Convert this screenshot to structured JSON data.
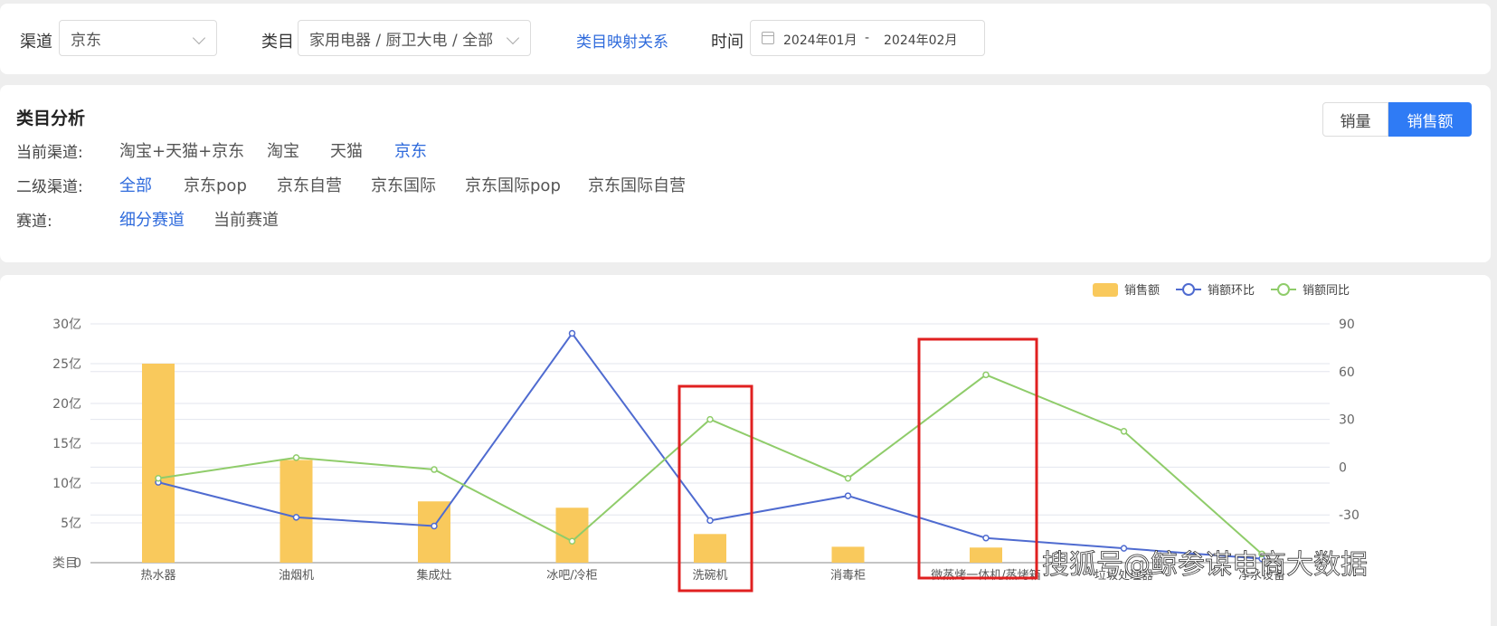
{
  "filters": {
    "channel_label": "渠道",
    "channel_value": "京东",
    "category_label": "类目",
    "category_value": "家用电器 / 厨卫大电 / 全部",
    "mapping_link": "类目映射关系",
    "time_label": "时间",
    "date_start": "2024年01月",
    "date_sep": "-",
    "date_end": "2024年02月"
  },
  "analysis": {
    "title": "类目分析",
    "metric_toggle": [
      "销量",
      "销售额"
    ],
    "active_metric": "销售额",
    "channel_row": {
      "label": "当前渠道:",
      "options": [
        "淘宝+天猫+京东",
        "淘宝",
        "天猫",
        "京东"
      ],
      "active": "京东"
    },
    "subchannel_row": {
      "label": "二级渠道:",
      "options": [
        "全部",
        "京东pop",
        "京东自营",
        "京东国际",
        "京东国际pop",
        "京东国际自营"
      ],
      "active": "全部"
    },
    "track_row": {
      "label": "赛道:",
      "options": [
        "细分赛道",
        "当前赛道"
      ],
      "active": "细分赛道"
    }
  },
  "chart_data": {
    "type": "bar",
    "categories": [
      "热水器",
      "油烟机",
      "集成灶",
      "冰吧/冷柜",
      "洗碗机",
      "消毒柜",
      "微蒸烤一体机/蒸烤箱",
      "垃圾处理器",
      "净水设备"
    ],
    "category_labels_shown": [
      "热水器",
      "油烟机",
      "集成灶",
      "冰吧/冷柜",
      "洗碗机",
      "消毒柜",
      "微蒸烤一体机/蒸烤箱",
      "垃圾处理器",
      "净水设备"
    ],
    "left_axis_ticks": [
      "0",
      "5亿",
      "10亿",
      "15亿",
      "20亿",
      "25亿",
      "30亿"
    ],
    "right_axis_ticks": [
      "-30",
      "0",
      "30",
      "60",
      "90"
    ],
    "left_axis_caption": "类目",
    "ylim_left": [
      0,
      30
    ],
    "ylim_right": [
      -60,
      90
    ],
    "series": [
      {
        "name": "销售额",
        "kind": "bar",
        "axis": "left",
        "color": "#f9c95c",
        "values": [
          25,
          12.9,
          7.7,
          6.9,
          3.6,
          2.0,
          1.9,
          0,
          0
        ]
      },
      {
        "name": "销额环比",
        "kind": "line",
        "axis": "left",
        "color": "#4f6bd0",
        "values": [
          10.1,
          5.7,
          4.6,
          28.8,
          5.3,
          8.4,
          3.1,
          1.8,
          0.5
        ]
      },
      {
        "name": "销额同比",
        "kind": "line",
        "axis": "left",
        "color": "#8fcc6a",
        "values": [
          10.6,
          13.2,
          11.7,
          2.7,
          18.0,
          10.6,
          23.6,
          16.5,
          1.1
        ]
      }
    ],
    "legend": "top-right",
    "grid": true
  },
  "highlights": [
    "洗碗机",
    "微蒸烤一体机/蒸烤箱"
  ],
  "watermark": "搜狐号@鲸参谋电商大数据",
  "colors": {
    "accent": "#2f7bf5",
    "link": "#2f6bdc",
    "highlight_box": "#e02020"
  }
}
